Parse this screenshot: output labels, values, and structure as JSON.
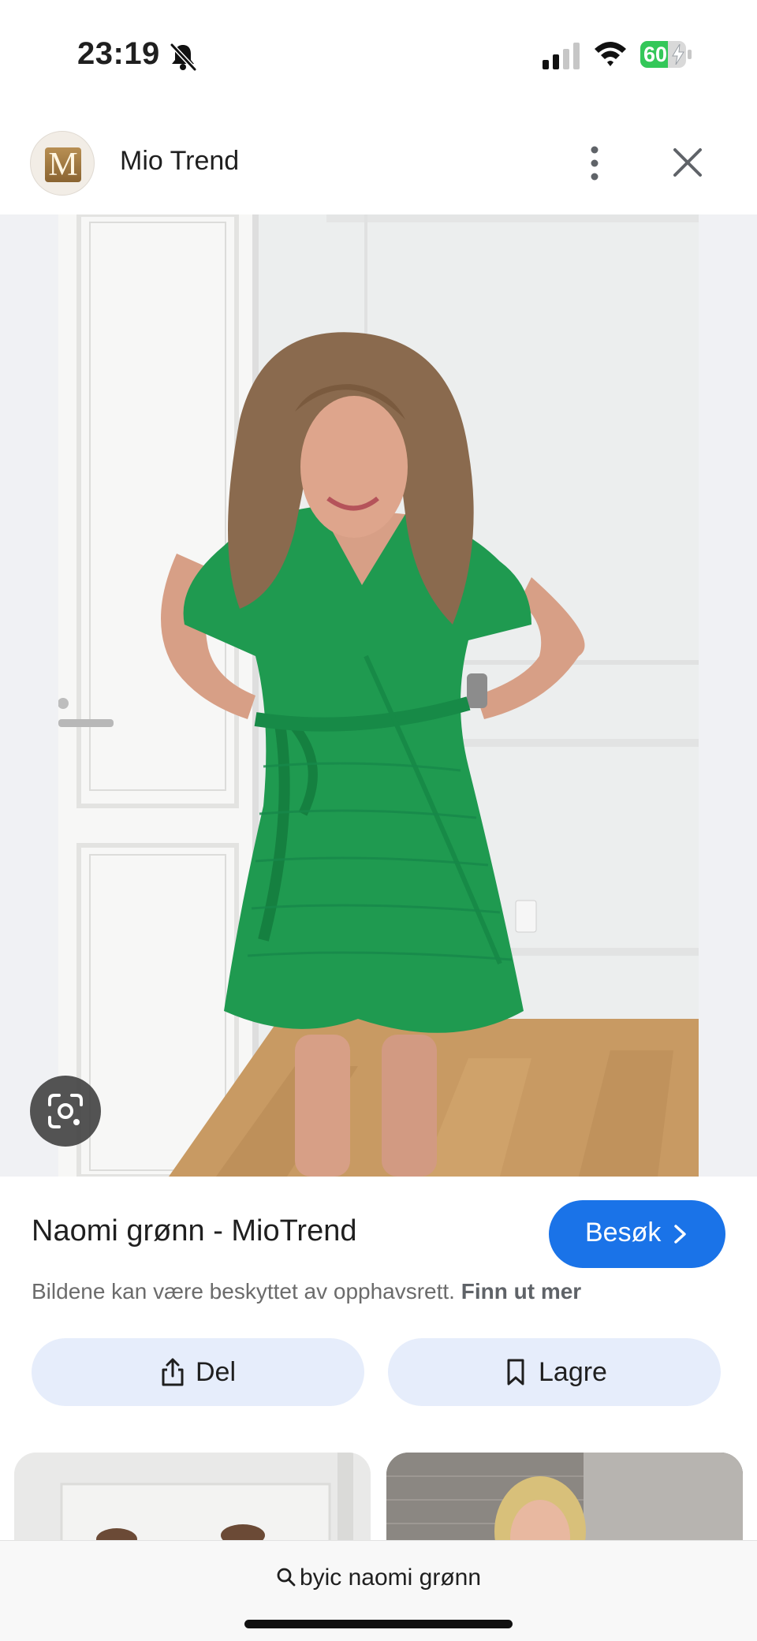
{
  "status_bar": {
    "time": "23:19",
    "battery_level": "60",
    "icons": [
      "bell-slash-icon",
      "signal-icon",
      "wifi-icon",
      "battery-charging-icon"
    ]
  },
  "header": {
    "logo_letter": "M",
    "site_name": "Mio Trend",
    "icons": [
      "more-vertical-icon",
      "close-icon"
    ]
  },
  "image": {
    "overlay_icon": "lens-icon"
  },
  "result": {
    "title": "Naomi grønn - MioTrend",
    "visit_label": "Besøk",
    "visit_icon": "chevron-right-icon",
    "copyright_text": "Bildene kan være beskyttet av opphavsrett.",
    "learn_more": "Finn ut mer"
  },
  "actions": {
    "share_label": "Del",
    "share_icon": "share-icon",
    "save_label": "Lagre",
    "save_icon": "bookmark-icon"
  },
  "search": {
    "query": "byic naomi grønn",
    "icon": "search-icon"
  },
  "colors": {
    "accent_blue": "#1a73e8",
    "action_button_bg": "#e6edfb",
    "battery_green": "#34c759",
    "dress_green": "#1f9a50"
  }
}
